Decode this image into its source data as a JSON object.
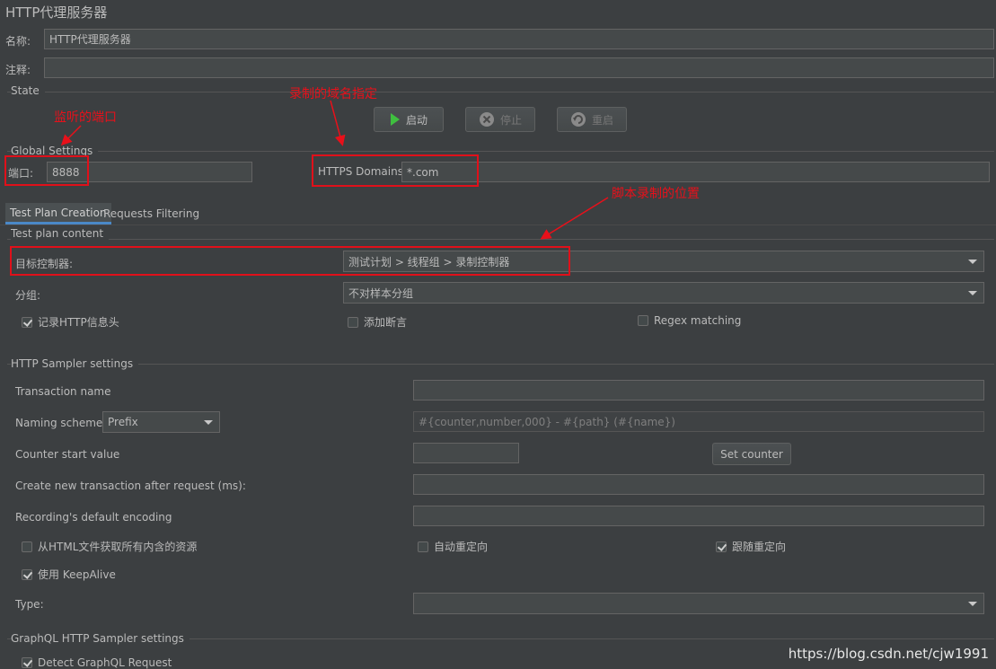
{
  "window_title": "HTTP代理服务器",
  "name_label": "名称:",
  "name_value": "HTTP代理服务器",
  "comment_label": "注释:",
  "comment_value": "",
  "state_title": "State",
  "buttons": {
    "start": "启动",
    "stop": "停止",
    "restart": "重启"
  },
  "global_settings_title": "Global Settings",
  "port_label": "端口:",
  "port_value": "8888",
  "https_domains_label": "HTTPS Domains:",
  "https_domains_value": "*.com",
  "tabs": [
    "Test Plan Creation",
    "Requests Filtering"
  ],
  "test_plan_content_title": "Test plan content",
  "target_controller_label": "目标控制器:",
  "target_controller_value": "测试计划 > 线程组 > 录制控制器",
  "grouping_label": "分组:",
  "grouping_value": "不对样本分组",
  "checkboxes1": [
    {
      "label": "记录HTTP信息头",
      "checked": true
    },
    {
      "label": "添加断言",
      "checked": false
    },
    {
      "label": "Regex matching",
      "checked": false
    }
  ],
  "http_sampler_title": "HTTP Sampler settings",
  "transaction_name_label": "Transaction name",
  "transaction_name_value": "",
  "naming_scheme_label": "Naming scheme",
  "naming_scheme_value": "Prefix",
  "naming_format_placeholder": "#{counter,number,000} - #{path} (#{name})",
  "counter_start_label": "Counter start value",
  "counter_start_value": "",
  "set_counter_label": "Set counter",
  "new_transaction_label": "Create new transaction after request (ms):",
  "new_transaction_value": "",
  "default_encoding_label": "Recording's default encoding",
  "default_encoding_value": "",
  "checkboxes2": [
    {
      "label": "从HTML文件获取所有内含的资源",
      "checked": false
    },
    {
      "label": "自动重定向",
      "checked": false
    },
    {
      "label": "跟随重定向",
      "checked": true
    },
    {
      "label": "使用 KeepAlive",
      "checked": true
    }
  ],
  "type_label": "Type:",
  "type_value": "",
  "graphql_title": "GraphQL HTTP Sampler settings",
  "detect_graphql_label": "Detect GraphQL Request",
  "detect_graphql_checked": true,
  "annotations": {
    "port": "监听的端口",
    "domain": "录制的域名指定",
    "location": "脚本录制的位置"
  },
  "watermark": "https://blog.csdn.net/cjw1991",
  "colors": {
    "background": "#3c3f41",
    "field": "#45494a",
    "annotation": "#e8101a",
    "tab_accent": "#4a88c7",
    "start_icon": "#3fbf3f"
  }
}
